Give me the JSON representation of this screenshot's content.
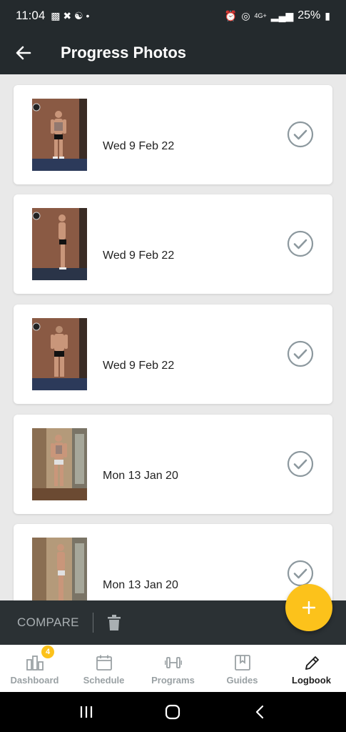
{
  "status_bar": {
    "time": "11:04",
    "battery": "25%",
    "signal_label": "4G+"
  },
  "app_bar": {
    "title": "Progress Photos"
  },
  "photos": [
    {
      "date": "Wed 9 Feb 22",
      "pose": "front"
    },
    {
      "date": "Wed 9 Feb 22",
      "pose": "side"
    },
    {
      "date": "Wed 9 Feb 22",
      "pose": "back"
    },
    {
      "date": "Mon 13 Jan 20",
      "pose": "front-mirror"
    },
    {
      "date": "Mon 13 Jan 20",
      "pose": "side-mirror"
    }
  ],
  "action_bar": {
    "compare_label": "COMPARE"
  },
  "bottom_nav": {
    "items": [
      {
        "label": "Dashboard",
        "icon": "dashboard-icon",
        "badge": "4"
      },
      {
        "label": "Schedule",
        "icon": "calendar-icon"
      },
      {
        "label": "Programs",
        "icon": "dumbbell-icon"
      },
      {
        "label": "Guides",
        "icon": "book-icon"
      },
      {
        "label": "Logbook",
        "icon": "pencil-icon",
        "active": true
      }
    ]
  },
  "colors": {
    "header": "#242a2d",
    "accent": "#fcc21b",
    "check": "#8c989e"
  }
}
